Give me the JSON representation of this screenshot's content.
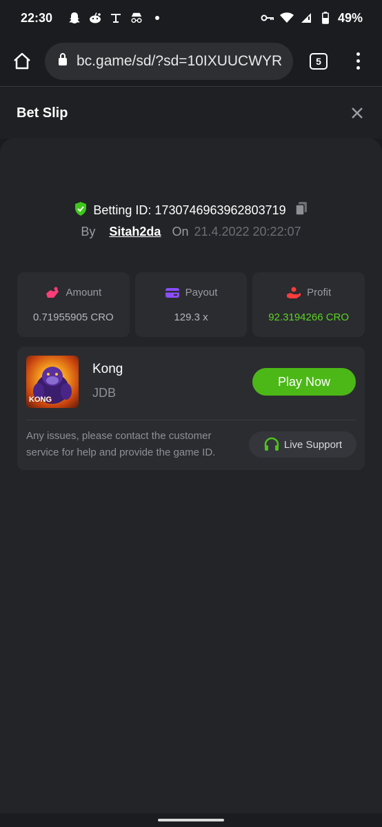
{
  "status": {
    "time": "22:30",
    "battery": "49%"
  },
  "browser": {
    "url": "bc.game/sd/?sd=10IXUUCWYR",
    "tab_count": "5"
  },
  "header": {
    "title": "Bet Slip"
  },
  "bet": {
    "betting_id": "Betting ID: 1730746963962803719",
    "by_label": "By",
    "user": "Sitah2da",
    "on_label": "On",
    "date": "21.4.2022 20:22:07"
  },
  "stats": [
    {
      "label": "Amount",
      "value": "0.71955905 CRO"
    },
    {
      "label": "Payout",
      "value": "129.3 x"
    },
    {
      "label": "Profit",
      "value": "92.3194266 CRO"
    }
  ],
  "game": {
    "thumb_label": "KONG",
    "name": "Kong",
    "provider": "JDB",
    "play_label": "Play Now",
    "help_text": "Any issues, please contact the customer service for help and provide the game ID.",
    "support_label": "Live Support"
  },
  "colors": {
    "accent_green": "#4cb817",
    "profit_green": "#5ad422",
    "background": "#1a1b1e",
    "card": "#2b2c30"
  }
}
